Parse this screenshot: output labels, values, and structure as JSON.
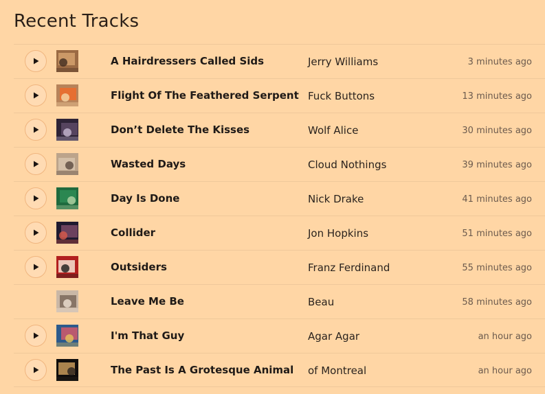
{
  "page": {
    "title": "Recent Tracks"
  },
  "tracks": [
    {
      "title": "A Hairdressers Called Sids",
      "artist": "Jerry Williams",
      "time": "3 minutes ago",
      "has_play": true,
      "art_colors": [
        "#9b6b44",
        "#d3a16d",
        "#3f2a1f"
      ]
    },
    {
      "title": "Flight Of The Feathered Serpent",
      "artist": "Fuck Buttons",
      "time": "13 minutes ago",
      "has_play": true,
      "art_colors": [
        "#b7835a",
        "#ef6c2b",
        "#f5d7a6"
      ]
    },
    {
      "title": "Don’t Delete The Kisses",
      "artist": "Wolf Alice",
      "time": "30 minutes ago",
      "has_play": true,
      "art_colors": [
        "#2d2336",
        "#5e4a66",
        "#c5b8d0"
      ]
    },
    {
      "title": "Wasted Days",
      "artist": "Cloud Nothings",
      "time": "39 minutes ago",
      "has_play": true,
      "art_colors": [
        "#bca48b",
        "#d7c4ad",
        "#5b4a3f"
      ]
    },
    {
      "title": "Day Is Done",
      "artist": "Nick Drake",
      "time": "41 minutes ago",
      "has_play": true,
      "art_colors": [
        "#1f6a3e",
        "#2e8c55",
        "#b6d4a6"
      ]
    },
    {
      "title": "Collider",
      "artist": "Jon Hopkins",
      "time": "51 minutes ago",
      "has_play": true,
      "art_colors": [
        "#1f1a2f",
        "#7a4a66",
        "#d95a4a"
      ]
    },
    {
      "title": "Outsiders",
      "artist": "Franz Ferdinand",
      "time": "55 minutes ago",
      "has_play": true,
      "art_colors": [
        "#b21f1f",
        "#f4e4d5",
        "#1c1c1c"
      ]
    },
    {
      "title": "Leave Me Be",
      "artist": "Beau",
      "time": "58 minutes ago",
      "has_play": false,
      "art_colors": [
        "#c9b7a6",
        "#7c6a5c",
        "#f0e2d5"
      ]
    },
    {
      "title": "I'm That Guy",
      "artist": "Agar Agar",
      "time": "an hour ago",
      "has_play": true,
      "art_colors": [
        "#2c5a8c",
        "#d25a6a",
        "#e6c35a"
      ]
    },
    {
      "title": "The Past Is A Grotesque Animal",
      "artist": "of Montreal",
      "time": "an hour ago",
      "has_play": true,
      "art_colors": [
        "#0f0d0c",
        "#c69a5a",
        "#2a241f"
      ]
    }
  ],
  "colors": {
    "background": "#ffd6a5",
    "row_border": "#efc89a",
    "play_border": "#f0b57f",
    "text": "#1f1a17",
    "muted_text": "#6b5a4d"
  },
  "icons": {
    "play": "play-icon"
  }
}
